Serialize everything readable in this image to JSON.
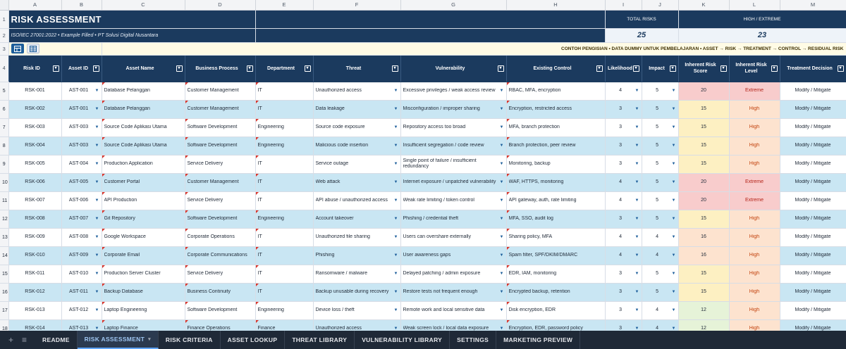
{
  "columns": [
    "A",
    "B",
    "C",
    "D",
    "E",
    "F",
    "G",
    "H",
    "I",
    "J",
    "K",
    "L",
    "M"
  ],
  "banner": {
    "title": "RISK ASSESSMENT",
    "subtitle": "ISO/IEC 27001:2022  •  Example Filled  •  PT Solusi Digital Nusantara",
    "kpis": [
      {
        "label": "TOTAL RISKS",
        "value": "25"
      },
      {
        "label": "HIGH / EXTREME",
        "value": "23"
      }
    ],
    "note": "CONTOH PENGISIAN  •  DATA DUMMY UNTUK PEMBELAJARAN  •  ASSET → RISK → TREATMENT → CONTROL → RESIDUAL RISK"
  },
  "headers": [
    "Risk ID",
    "Asset ID",
    "Asset Name",
    "Business Process",
    "Department",
    "Threat",
    "Vulnerability",
    "Existing Control",
    "Likelihood",
    "Impact",
    "Inherent Risk Score",
    "Inherent Risk Level",
    "Treatment Decision"
  ],
  "level_colors": {
    "Extreme": {
      "bg": "#f8cccc",
      "fg": "#b42318"
    },
    "High": {
      "bg": "#fde3cf",
      "fg": "#c2410c"
    }
  },
  "score_colors": {
    "20": "#f8cccc",
    "16": "#fde3cf",
    "15": "#fdf0c2",
    "12": "#e6f3d8"
  },
  "rows": [
    {
      "row": "5",
      "risk_id": "RSK-001",
      "asset_id": "AST-001",
      "asset_name": "Database Pelanggan",
      "process": "Customer Management",
      "dept": "IT",
      "threat": "Unauthorized access",
      "vuln": "Excessive privileges / weak access review",
      "control": "RBAC, MFA, encryption",
      "likelihood": "4",
      "impact": "5",
      "score": "20",
      "level": "Extreme",
      "treatment": "Modify / Mitigate"
    },
    {
      "row": "6",
      "risk_id": "RSK-002",
      "asset_id": "AST-001",
      "asset_name": "Database Pelanggan",
      "process": "Customer Management",
      "dept": "IT",
      "threat": "Data leakage",
      "vuln": "Misconfiguration / improper sharing",
      "control": "Encryption, restricted access",
      "likelihood": "3",
      "impact": "5",
      "score": "15",
      "level": "High",
      "treatment": "Modify / Mitigate"
    },
    {
      "row": "7",
      "risk_id": "RSK-003",
      "asset_id": "AST-003",
      "asset_name": "Source Code Aplikasi Utama",
      "process": "Software Development",
      "dept": "Engineering",
      "threat": "Source code exposure",
      "vuln": "Repository access too broad",
      "control": "MFA, branch protection",
      "likelihood": "3",
      "impact": "5",
      "score": "15",
      "level": "High",
      "treatment": "Modify / Mitigate"
    },
    {
      "row": "8",
      "risk_id": "RSK-004",
      "asset_id": "AST-003",
      "asset_name": "Source Code Aplikasi Utama",
      "process": "Software Development",
      "dept": "Engineering",
      "threat": "Malicious code insertion",
      "vuln": "Insufficient segregation / code review",
      "control": "Branch protection, peer review",
      "likelihood": "3",
      "impact": "5",
      "score": "15",
      "level": "High",
      "treatment": "Modify / Mitigate"
    },
    {
      "row": "9",
      "risk_id": "RSK-005",
      "asset_id": "AST-004",
      "asset_name": "Production Application",
      "process": "Service Delivery",
      "dept": "IT",
      "threat": "Service outage",
      "vuln": "Single point of failure / insufficient redundancy",
      "control": "Monitoring, backup",
      "likelihood": "3",
      "impact": "5",
      "score": "15",
      "level": "High",
      "treatment": "Modify / Mitigate"
    },
    {
      "row": "10",
      "risk_id": "RSK-006",
      "asset_id": "AST-005",
      "asset_name": "Customer Portal",
      "process": "Customer Management",
      "dept": "IT",
      "threat": "Web attack",
      "vuln": "Internet exposure / unpatched vulnerability",
      "control": "WAF, HTTPS, monitoring",
      "likelihood": "4",
      "impact": "5",
      "score": "20",
      "level": "Extreme",
      "treatment": "Modify / Mitigate"
    },
    {
      "row": "11",
      "risk_id": "RSK-007",
      "asset_id": "AST-006",
      "asset_name": "API Production",
      "process": "Service Delivery",
      "dept": "IT",
      "threat": "API abuse / unauthorized access",
      "vuln": "Weak rate limiting / token control",
      "control": "API gateway, auth, rate limiting",
      "likelihood": "4",
      "impact": "5",
      "score": "20",
      "level": "Extreme",
      "treatment": "Modify / Mitigate"
    },
    {
      "row": "12",
      "risk_id": "RSK-008",
      "asset_id": "AST-007",
      "asset_name": "Git Repository",
      "process": "Software Development",
      "dept": "Engineering",
      "threat": "Account takeover",
      "vuln": "Phishing / credential theft",
      "control": "MFA, SSO, audit log",
      "likelihood": "3",
      "impact": "5",
      "score": "15",
      "level": "High",
      "treatment": "Modify / Mitigate"
    },
    {
      "row": "13",
      "risk_id": "RSK-009",
      "asset_id": "AST-008",
      "asset_name": "Google Workspace",
      "process": "Corporate Operations",
      "dept": "IT",
      "threat": "Unauthorized file sharing",
      "vuln": "Users can overshare externally",
      "control": "Sharing policy, MFA",
      "likelihood": "4",
      "impact": "4",
      "score": "16",
      "level": "High",
      "treatment": "Modify / Mitigate"
    },
    {
      "row": "14",
      "risk_id": "RSK-010",
      "asset_id": "AST-009",
      "asset_name": "Corporate Email",
      "process": "Corporate Communications",
      "dept": "IT",
      "threat": "Phishing",
      "vuln": "User awareness gaps",
      "control": "Spam filter, SPF/DKIM/DMARC",
      "likelihood": "4",
      "impact": "4",
      "score": "16",
      "level": "High",
      "treatment": "Modify / Mitigate"
    },
    {
      "row": "15",
      "risk_id": "RSK-011",
      "asset_id": "AST-010",
      "asset_name": "Production Server Cluster",
      "process": "Service Delivery",
      "dept": "IT",
      "threat": "Ransomware / malware",
      "vuln": "Delayed patching / admin exposure",
      "control": "EDR, IAM, monitoring",
      "likelihood": "3",
      "impact": "5",
      "score": "15",
      "level": "High",
      "treatment": "Modify / Mitigate"
    },
    {
      "row": "16",
      "risk_id": "RSK-012",
      "asset_id": "AST-011",
      "asset_name": "Backup Database",
      "process": "Business Continuity",
      "dept": "IT",
      "threat": "Backup unusable during recovery",
      "vuln": "Restore tests not frequent enough",
      "control": "Encrypted backup, retention",
      "likelihood": "3",
      "impact": "5",
      "score": "15",
      "level": "High",
      "treatment": "Modify / Mitigate"
    },
    {
      "row": "17",
      "risk_id": "RSK-013",
      "asset_id": "AST-012",
      "asset_name": "Laptop Engineering",
      "process": "Software Development",
      "dept": "Engineering",
      "threat": "Device loss / theft",
      "vuln": "Remote work and local sensitive data",
      "control": "Disk encryption, EDR",
      "likelihood": "3",
      "impact": "4",
      "score": "12",
      "level": "High",
      "treatment": "Modify / Mitigate"
    },
    {
      "row": "18",
      "risk_id": "RSK-014",
      "asset_id": "AST-013",
      "asset_name": "Laptop Finance",
      "process": "Finance Operations",
      "dept": "Finance",
      "threat": "Unauthorized access",
      "vuln": "Weak screen lock / local data exposure",
      "control": "Encryption, EDR, password policy",
      "likelihood": "3",
      "impact": "4",
      "score": "12",
      "level": "High",
      "treatment": "Modify / Mitigate"
    }
  ],
  "tabs": [
    {
      "label": "README",
      "active": false
    },
    {
      "label": "RISK ASSESSMENT",
      "active": true
    },
    {
      "label": "RISK CRITERIA",
      "active": false
    },
    {
      "label": "ASSET LOOKUP",
      "active": false
    },
    {
      "label": "THREAT LIBRARY",
      "active": false
    },
    {
      "label": "VULNERABILITY LIBRARY",
      "active": false
    },
    {
      "label": "SETTINGS",
      "active": false
    },
    {
      "label": "MARKETING PREVIEW",
      "active": false
    }
  ],
  "icons": {
    "add": "plus-icon",
    "menu": "hamburger-icon",
    "dropdown": "chevron-down-icon"
  }
}
